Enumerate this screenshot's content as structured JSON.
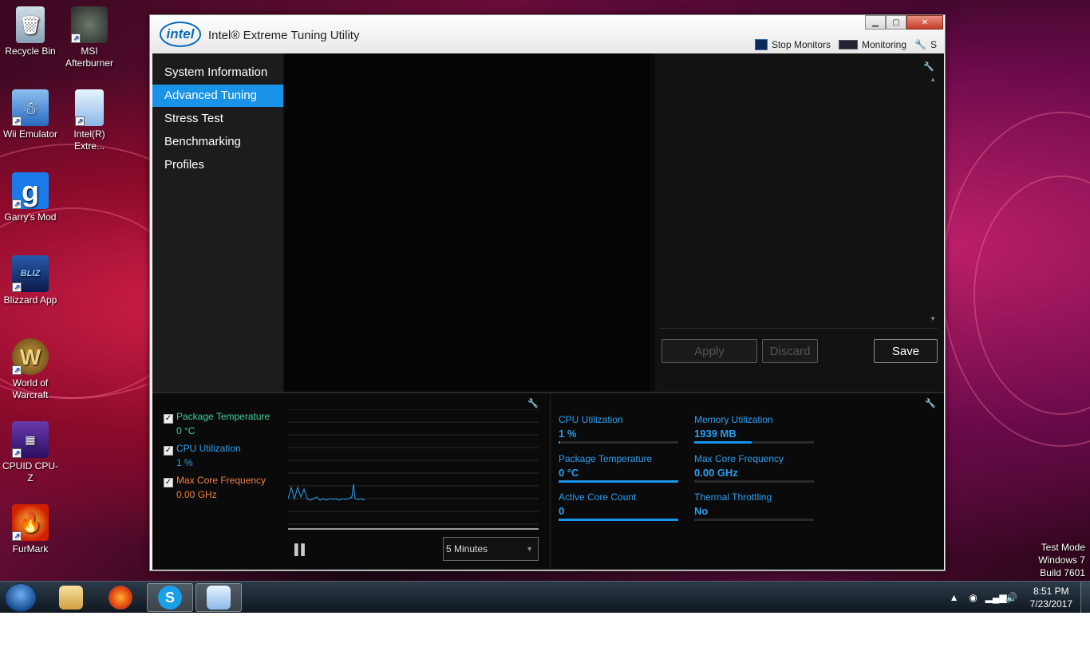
{
  "desktop": {
    "icons": [
      {
        "label": "Recycle Bin"
      },
      {
        "label": "MSI Afterburner"
      },
      {
        "label": "Wii Emulator"
      },
      {
        "label": "Intel(R) Extre..."
      },
      {
        "label": "Garry's Mod"
      },
      {
        "label": "Blizzard App"
      },
      {
        "label": "World of Warcraft"
      },
      {
        "label": "CPUID CPU-Z"
      },
      {
        "label": "FurMark"
      }
    ],
    "test_mode": [
      "Test Mode",
      "Windows 7",
      "Build 7601"
    ]
  },
  "taskbar": {
    "clock_time": "8:51 PM",
    "clock_date": "7/23/2017"
  },
  "window": {
    "logo": "intel",
    "title": "Intel® Extreme Tuning Utility",
    "tools": {
      "stop_monitors": "Stop Monitors",
      "monitoring": "Monitoring",
      "settings": "S"
    }
  },
  "nav": {
    "items": [
      {
        "label": "System Information",
        "active": false
      },
      {
        "label": "Advanced Tuning",
        "active": true
      },
      {
        "label": "Stress Test",
        "active": false
      },
      {
        "label": "Benchmarking",
        "active": false
      },
      {
        "label": "Profiles",
        "active": false
      }
    ]
  },
  "actions": {
    "apply": "Apply",
    "discard": "Discard",
    "save": "Save"
  },
  "monitor": {
    "legend": [
      {
        "label": "Package Temperature",
        "value": "0 °C",
        "color": "#3fd09a",
        "checked": true
      },
      {
        "label": "CPU Utilization",
        "value": "1 %",
        "color": "#2a9ef0",
        "checked": true
      },
      {
        "label": "Max Core Frequency",
        "value": "0.00 GHz",
        "color": "#f08038",
        "checked": true
      }
    ],
    "interval": "5 Minutes",
    "stats": [
      {
        "label": "CPU Utilization",
        "value": "1 %",
        "fill": 0.01
      },
      {
        "label": "Memory Utilization",
        "value": "1939  MB",
        "fill": 0.48
      },
      {
        "label": "Package Temperature",
        "value": "0 °C",
        "fill": 1.0
      },
      {
        "label": "Max Core Frequency",
        "value": "0.00 GHz",
        "fill": 0.0
      },
      {
        "label": "Active Core Count",
        "value": "0",
        "fill": 1.0
      },
      {
        "label": "Thermal Throttling",
        "value": "No",
        "fill": 0.0
      }
    ]
  },
  "colors": {
    "accent": "#1893e8",
    "intel_blue": "#0a6bbd"
  }
}
